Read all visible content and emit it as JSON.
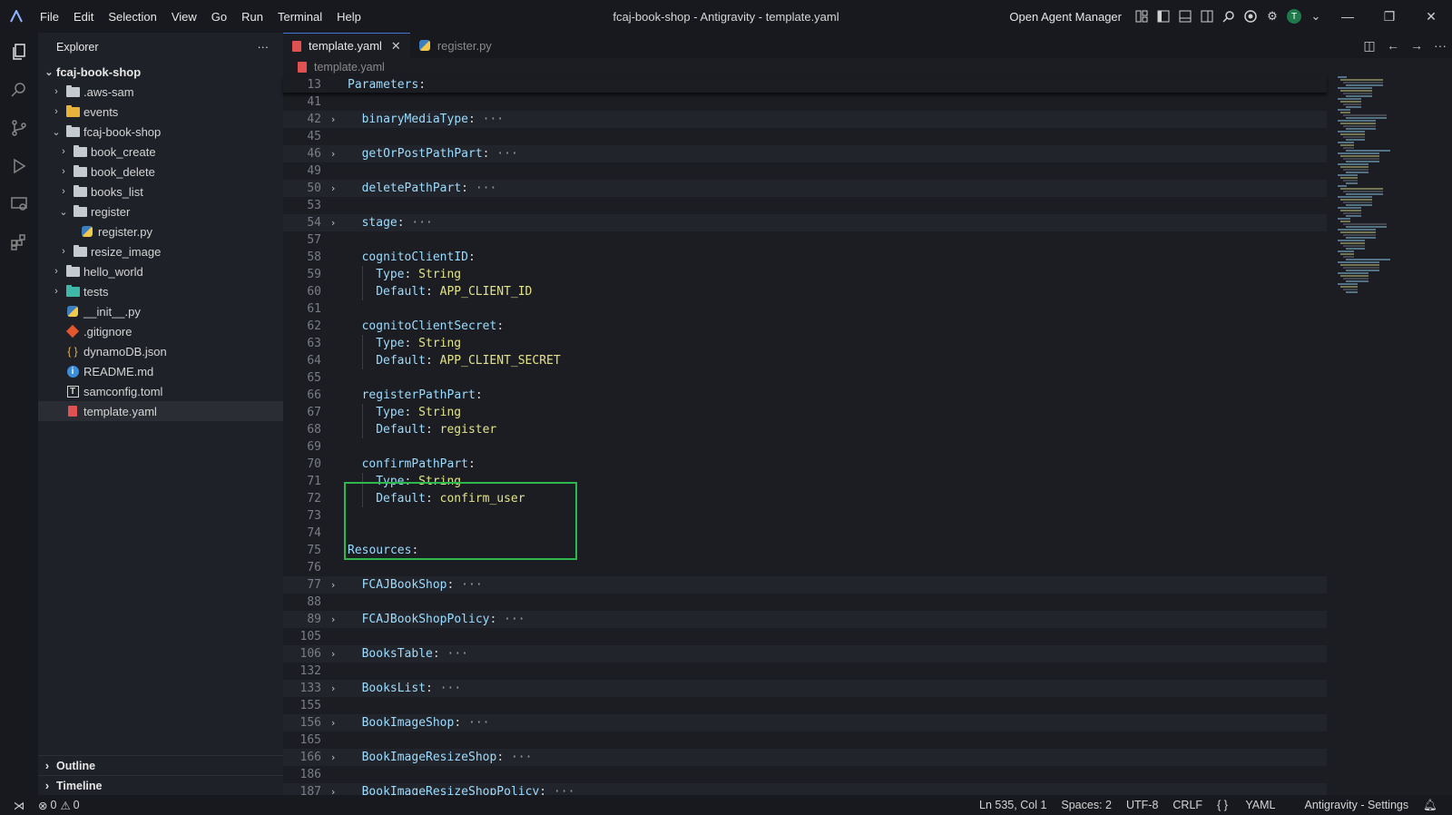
{
  "window": {
    "title": "fcaj-book-shop - Antigravity - template.yaml",
    "menu": [
      "File",
      "Edit",
      "Selection",
      "View",
      "Go",
      "Run",
      "Terminal",
      "Help"
    ],
    "agent_manager_label": "Open Agent Manager",
    "avatar_initial": "T"
  },
  "explorer": {
    "title": "Explorer",
    "more_label": "···",
    "items": [
      {
        "label": "fcaj-book-shop",
        "depth": 0,
        "chevron": "open",
        "icon": "none",
        "root": true
      },
      {
        "label": ".aws-sam",
        "depth": 1,
        "chevron": "closed",
        "icon": "folder"
      },
      {
        "label": "events",
        "depth": 1,
        "chevron": "closed",
        "icon": "folder-yellow"
      },
      {
        "label": "fcaj-book-shop",
        "depth": 1,
        "chevron": "open",
        "icon": "folder"
      },
      {
        "label": "book_create",
        "depth": 2,
        "chevron": "closed",
        "icon": "folder"
      },
      {
        "label": "book_delete",
        "depth": 2,
        "chevron": "closed",
        "icon": "folder"
      },
      {
        "label": "books_list",
        "depth": 2,
        "chevron": "closed",
        "icon": "folder"
      },
      {
        "label": "register",
        "depth": 2,
        "chevron": "open",
        "icon": "folder"
      },
      {
        "label": "register.py",
        "depth": 3,
        "chevron": "none",
        "icon": "python"
      },
      {
        "label": "resize_image",
        "depth": 2,
        "chevron": "closed",
        "icon": "folder"
      },
      {
        "label": "hello_world",
        "depth": 1,
        "chevron": "closed",
        "icon": "folder"
      },
      {
        "label": "tests",
        "depth": 1,
        "chevron": "closed",
        "icon": "folder-teal"
      },
      {
        "label": "__init__.py",
        "depth": 1,
        "chevron": "none",
        "icon": "python"
      },
      {
        "label": ".gitignore",
        "depth": 1,
        "chevron": "none",
        "icon": "git"
      },
      {
        "label": "dynamoDB.json",
        "depth": 1,
        "chevron": "none",
        "icon": "json"
      },
      {
        "label": "README.md",
        "depth": 1,
        "chevron": "none",
        "icon": "info"
      },
      {
        "label": "samconfig.toml",
        "depth": 1,
        "chevron": "none",
        "icon": "toml"
      },
      {
        "label": "template.yaml",
        "depth": 1,
        "chevron": "none",
        "icon": "yaml",
        "selected": true
      }
    ],
    "outline_label": "Outline",
    "timeline_label": "Timeline"
  },
  "tabs": [
    {
      "label": "template.yaml",
      "active": true,
      "icon": "yaml",
      "close": "✕"
    },
    {
      "label": "register.py",
      "active": false,
      "icon": "python"
    }
  ],
  "breadcrumb": "template.yaml",
  "code_lines": [
    {
      "ln": "13",
      "indent": 0,
      "key": "Parameters",
      "value": "",
      "fold": false,
      "folded": false,
      "sticky": true
    },
    {
      "ln": "41",
      "indent": 0,
      "key": "",
      "value": "",
      "fold": false,
      "folded": false
    },
    {
      "ln": "42",
      "indent": 1,
      "key": "binaryMediaType",
      "value": "",
      "fold": true,
      "folded": true
    },
    {
      "ln": "45",
      "indent": 0,
      "key": "",
      "value": "",
      "fold": false,
      "folded": false
    },
    {
      "ln": "46",
      "indent": 1,
      "key": "getOrPostPathPart",
      "value": "",
      "fold": true,
      "folded": true
    },
    {
      "ln": "49",
      "indent": 0,
      "key": "",
      "value": "",
      "fold": false,
      "folded": false
    },
    {
      "ln": "50",
      "indent": 1,
      "key": "deletePathPart",
      "value": "",
      "fold": true,
      "folded": true
    },
    {
      "ln": "53",
      "indent": 0,
      "key": "",
      "value": "",
      "fold": false,
      "folded": false
    },
    {
      "ln": "54",
      "indent": 1,
      "key": "stage",
      "value": "",
      "fold": true,
      "folded": true
    },
    {
      "ln": "57",
      "indent": 0,
      "key": "",
      "value": "",
      "fold": false,
      "folded": false
    },
    {
      "ln": "58",
      "indent": 1,
      "key": "cognitoClientID",
      "value": "",
      "fold": false,
      "folded": false
    },
    {
      "ln": "59",
      "indent": 2,
      "key": "Type",
      "value": "String",
      "fold": false,
      "folded": false
    },
    {
      "ln": "60",
      "indent": 2,
      "key": "Default",
      "value": "APP_CLIENT_ID",
      "fold": false,
      "folded": false
    },
    {
      "ln": "61",
      "indent": 0,
      "key": "",
      "value": "",
      "fold": false,
      "folded": false
    },
    {
      "ln": "62",
      "indent": 1,
      "key": "cognitoClientSecret",
      "value": "",
      "fold": false,
      "folded": false
    },
    {
      "ln": "63",
      "indent": 2,
      "key": "Type",
      "value": "String",
      "fold": false,
      "folded": false
    },
    {
      "ln": "64",
      "indent": 2,
      "key": "Default",
      "value": "APP_CLIENT_SECRET",
      "fold": false,
      "folded": false
    },
    {
      "ln": "65",
      "indent": 0,
      "key": "",
      "value": "",
      "fold": false,
      "folded": false
    },
    {
      "ln": "66",
      "indent": 1,
      "key": "registerPathPart",
      "value": "",
      "fold": false,
      "folded": false
    },
    {
      "ln": "67",
      "indent": 2,
      "key": "Type",
      "value": "String",
      "fold": false,
      "folded": false
    },
    {
      "ln": "68",
      "indent": 2,
      "key": "Default",
      "value": "register",
      "fold": false,
      "folded": false
    },
    {
      "ln": "69",
      "indent": 0,
      "key": "",
      "value": "",
      "fold": false,
      "folded": false
    },
    {
      "ln": "70",
      "indent": 1,
      "key": "confirmPathPart",
      "value": "",
      "fold": false,
      "folded": false
    },
    {
      "ln": "71",
      "indent": 2,
      "key": "Type",
      "value": "String",
      "fold": false,
      "folded": false
    },
    {
      "ln": "72",
      "indent": 2,
      "key": "Default",
      "value": "confirm_user",
      "fold": false,
      "folded": false
    },
    {
      "ln": "73",
      "indent": 0,
      "key": "",
      "value": "",
      "fold": false,
      "folded": false
    },
    {
      "ln": "74",
      "indent": 0,
      "key": "",
      "value": "",
      "fold": false,
      "folded": false
    },
    {
      "ln": "75",
      "indent": 0,
      "key": "Resources",
      "value": "",
      "fold": false,
      "folded": false
    },
    {
      "ln": "76",
      "indent": 0,
      "key": "",
      "value": "",
      "fold": false,
      "folded": false
    },
    {
      "ln": "77",
      "indent": 1,
      "key": "FCAJBookShop",
      "value": "",
      "fold": true,
      "folded": true
    },
    {
      "ln": "88",
      "indent": 0,
      "key": "",
      "value": "",
      "fold": false,
      "folded": false
    },
    {
      "ln": "89",
      "indent": 1,
      "key": "FCAJBookShopPolicy",
      "value": "",
      "fold": true,
      "folded": true
    },
    {
      "ln": "105",
      "indent": 0,
      "key": "",
      "value": "",
      "fold": false,
      "folded": false
    },
    {
      "ln": "106",
      "indent": 1,
      "key": "BooksTable",
      "value": "",
      "fold": true,
      "folded": true
    },
    {
      "ln": "132",
      "indent": 0,
      "key": "",
      "value": "",
      "fold": false,
      "folded": false
    },
    {
      "ln": "133",
      "indent": 1,
      "key": "BooksList",
      "value": "",
      "fold": true,
      "folded": true
    },
    {
      "ln": "155",
      "indent": 0,
      "key": "",
      "value": "",
      "fold": false,
      "folded": false
    },
    {
      "ln": "156",
      "indent": 1,
      "key": "BookImageShop",
      "value": "",
      "fold": true,
      "folded": true
    },
    {
      "ln": "165",
      "indent": 0,
      "key": "",
      "value": "",
      "fold": false,
      "folded": false
    },
    {
      "ln": "166",
      "indent": 1,
      "key": "BookImageResizeShop",
      "value": "",
      "fold": true,
      "folded": true
    },
    {
      "ln": "186",
      "indent": 0,
      "key": "",
      "value": "",
      "fold": false,
      "folded": false
    },
    {
      "ln": "187",
      "indent": 1,
      "key": "BookImageResizeShopPolicy",
      "value": "",
      "fold": true,
      "folded": true
    }
  ],
  "status": {
    "errors": "0",
    "warnings": "0",
    "position": "Ln 535, Col 1",
    "spaces": "Spaces: 2",
    "encoding": "UTF-8",
    "eol": "CRLF",
    "language": "YAML",
    "settings": "Antigravity - Settings"
  },
  "colors": {
    "highlight_box": "#2db84d",
    "key": "#9cdcfe",
    "value": "#e3e38a"
  }
}
